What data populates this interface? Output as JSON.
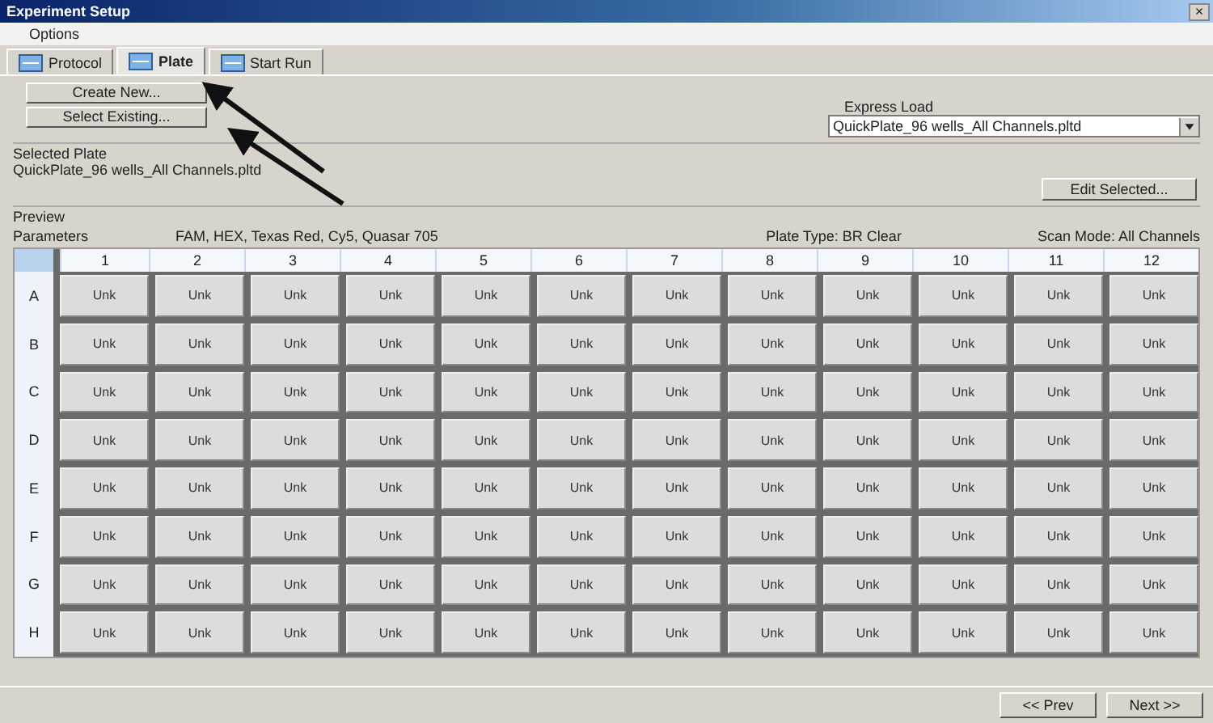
{
  "window": {
    "title": "Experiment Setup",
    "close": "×"
  },
  "menu": [
    "Options"
  ],
  "tabs": [
    {
      "label": "Protocol",
      "selected": false
    },
    {
      "label": "Plate",
      "selected": true
    },
    {
      "label": "Start Run",
      "selected": false
    }
  ],
  "plate_buttons": [
    "Create New...",
    "Select Existing..."
  ],
  "express_load": {
    "label": "Express Load",
    "value": "QuickPlate_96 wells_All Channels.pltd"
  },
  "selected_plate": {
    "label": "Selected Plate",
    "file": "QuickPlate_96 wells_All Channels.pltd",
    "edit_button": "Edit Selected..."
  },
  "preview": {
    "label": "Preview",
    "parameters_label": "Parameters",
    "parameters": "FAM, HEX, Texas Red, Cy5, Quasar 705",
    "plate_type": "Plate Type: BR Clear",
    "scan_mode": "Scan Mode: All Channels"
  },
  "grid": {
    "columns": [
      "1",
      "2",
      "3",
      "4",
      "5",
      "6",
      "7",
      "8",
      "9",
      "10",
      "11",
      "12"
    ],
    "rows": [
      {
        "label": "A",
        "wells": [
          "Unk",
          "Unk",
          "Unk",
          "Unk",
          "Unk",
          "Unk",
          "Unk",
          "Unk",
          "Unk",
          "Unk",
          "Unk",
          "Unk"
        ]
      },
      {
        "label": "B",
        "wells": [
          "Unk",
          "Unk",
          "Unk",
          "Unk",
          "Unk",
          "Unk",
          "Unk",
          "Unk",
          "Unk",
          "Unk",
          "Unk",
          "Unk"
        ]
      },
      {
        "label": "C",
        "wells": [
          "Unk",
          "Unk",
          "Unk",
          "Unk",
          "Unk",
          "Unk",
          "Unk",
          "Unk",
          "Unk",
          "Unk",
          "Unk",
          "Unk"
        ]
      },
      {
        "label": "D",
        "wells": [
          "Unk",
          "Unk",
          "Unk",
          "Unk",
          "Unk",
          "Unk",
          "Unk",
          "Unk",
          "Unk",
          "Unk",
          "Unk",
          "Unk"
        ]
      },
      {
        "label": "E",
        "wells": [
          "Unk",
          "Unk",
          "Unk",
          "Unk",
          "Unk",
          "Unk",
          "Unk",
          "Unk",
          "Unk",
          "Unk",
          "Unk",
          "Unk"
        ]
      },
      {
        "label": "F",
        "wells": [
          "Unk",
          "Unk",
          "Unk",
          "Unk",
          "Unk",
          "Unk",
          "Unk",
          "Unk",
          "Unk",
          "Unk",
          "Unk",
          "Unk"
        ]
      },
      {
        "label": "G",
        "wells": [
          "Unk",
          "Unk",
          "Unk",
          "Unk",
          "Unk",
          "Unk",
          "Unk",
          "Unk",
          "Unk",
          "Unk",
          "Unk",
          "Unk"
        ]
      },
      {
        "label": "H",
        "wells": [
          "Unk",
          "Unk",
          "Unk",
          "Unk",
          "Unk",
          "Unk",
          "Unk",
          "Unk",
          "Unk",
          "Unk",
          "Unk",
          "Unk"
        ]
      }
    ]
  },
  "nav_buttons": [
    "<< Prev",
    "Next >>"
  ]
}
